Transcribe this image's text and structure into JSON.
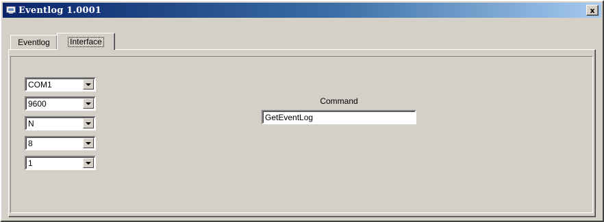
{
  "window": {
    "title": "Eventlog 1.0001",
    "close_label": "x"
  },
  "tabs": [
    {
      "label": "Eventlog",
      "active": false
    },
    {
      "label": "Interface",
      "active": true
    }
  ],
  "serial": {
    "port": "COM1",
    "baud": "9600",
    "parity": "N",
    "databits": "8",
    "stopbits": "1"
  },
  "command": {
    "label": "Command",
    "value": "GetEventLog"
  }
}
